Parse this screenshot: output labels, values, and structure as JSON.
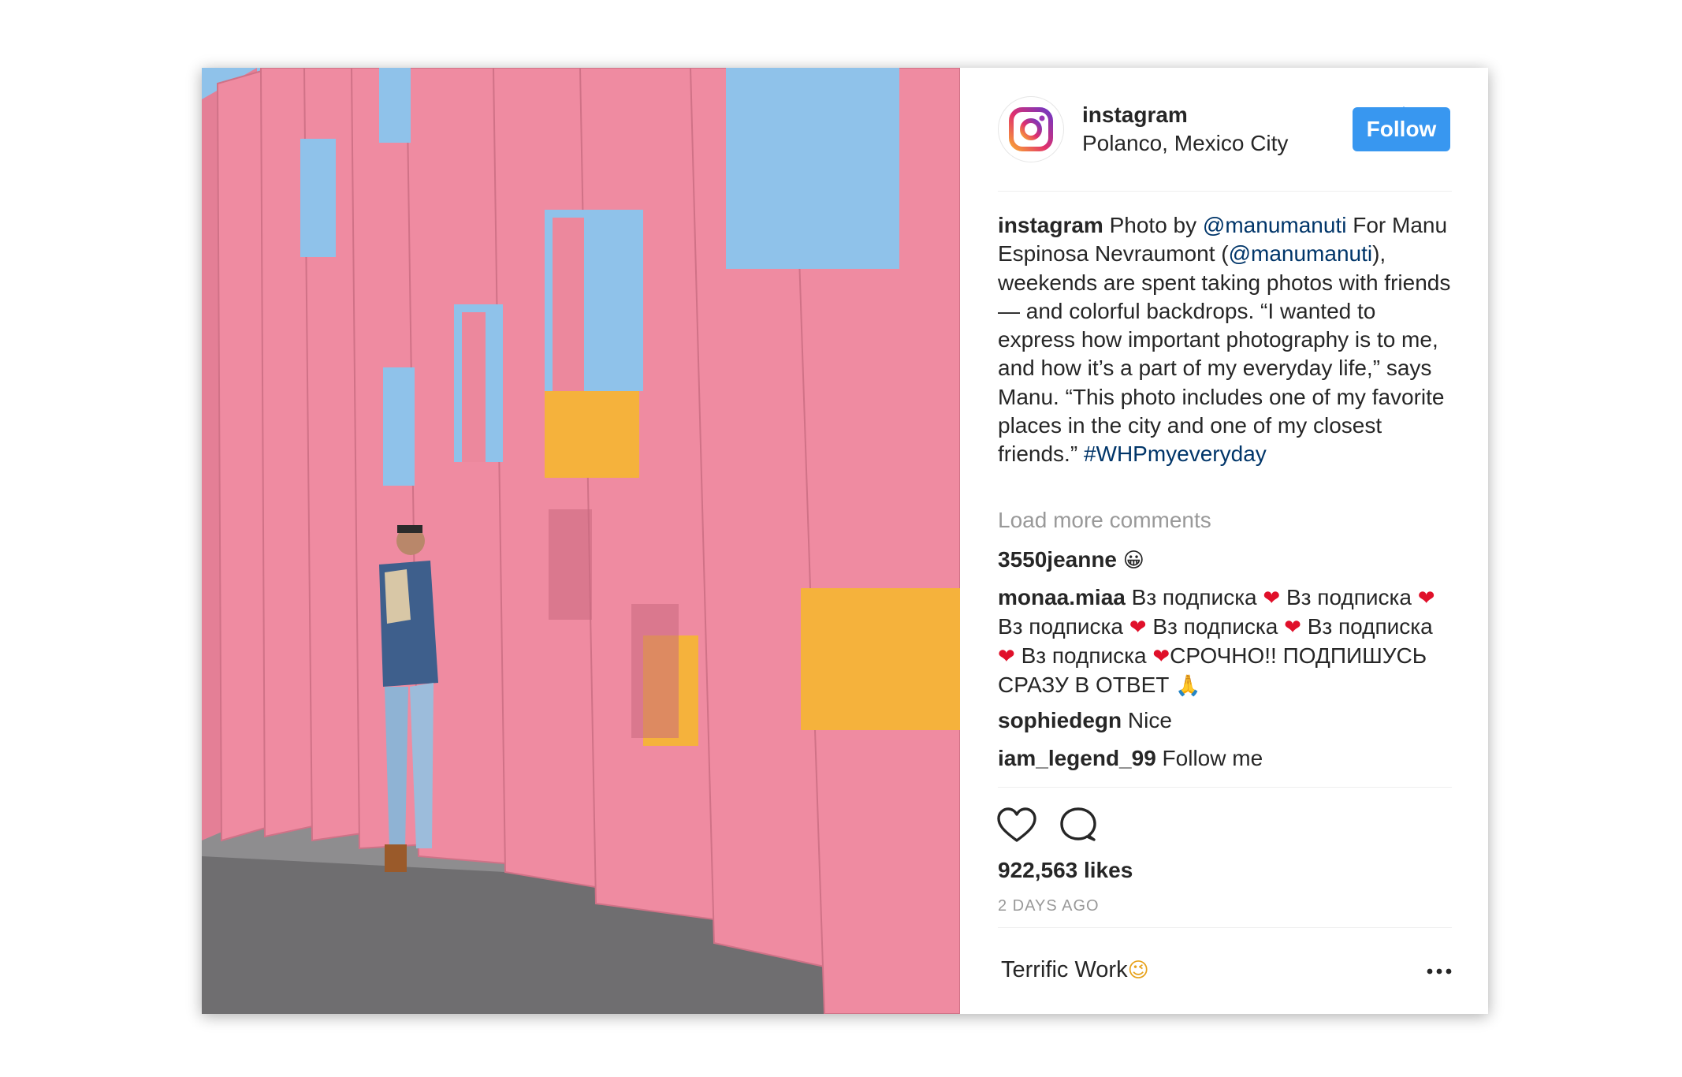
{
  "post": {
    "account": {
      "username": "instagram",
      "verified": true,
      "location": "Polanco, Mexico City",
      "follow_label": "Follow"
    },
    "photo": {
      "colors": {
        "pink": "#ef8ba1",
        "pink_shadow": "#c86a80",
        "sky": "#8fc2ea",
        "yellow": "#f5b23c",
        "ground": "#9a9a9a"
      }
    },
    "caption": {
      "username": "instagram",
      "text_1": " Photo by ",
      "mention_1": "@manumanuti",
      "text_2": " For Manu Espinosa Nevraumont (",
      "mention_2": "@manumanuti",
      "text_3": "), weekends are spent taking photos with friends — and colorful backdrops. “I wanted to express how important photography is to me, and how it’s a part of my everyday life,” says Manu. “This photo includes one of my favorite places in the city and one of my closest friends.” ",
      "hashtag": "#WHPmyeveryday"
    },
    "load_more_label": "Load more comments",
    "comments": [
      {
        "username": "3550jeanne",
        "text": " ",
        "emoji": "😀"
      },
      {
        "username": "monaa.miaa",
        "segments": [
          " Вз подписка ",
          "❤",
          " Вз подписка ",
          "❤",
          " Вз подписка ",
          "❤",
          " Вз подписка ",
          "❤",
          " Вз подписка ",
          "❤",
          " Вз подписка ",
          "❤",
          "СРОЧНО!! ПОДПИШУСЬ СРАЗУ В ОТВЕТ ",
          "🙏"
        ]
      },
      {
        "username": "sophiedegn",
        "text": " Nice"
      },
      {
        "username": "iam_legend_99",
        "text": " Follow me"
      }
    ],
    "actions": {
      "like_icon": "heart-outline-icon",
      "comment_icon": "speech-bubble-icon"
    },
    "likes_label": "922,563 likes",
    "timestamp": "2 DAYS AGO",
    "comment_input": {
      "text": "Terrific Work",
      "emoji": "😉"
    },
    "more_icon": "ellipsis-icon",
    "colors": {
      "follow_button": "#3897f0",
      "mention": "#003569",
      "muted": "#999999",
      "text": "#262626"
    }
  }
}
